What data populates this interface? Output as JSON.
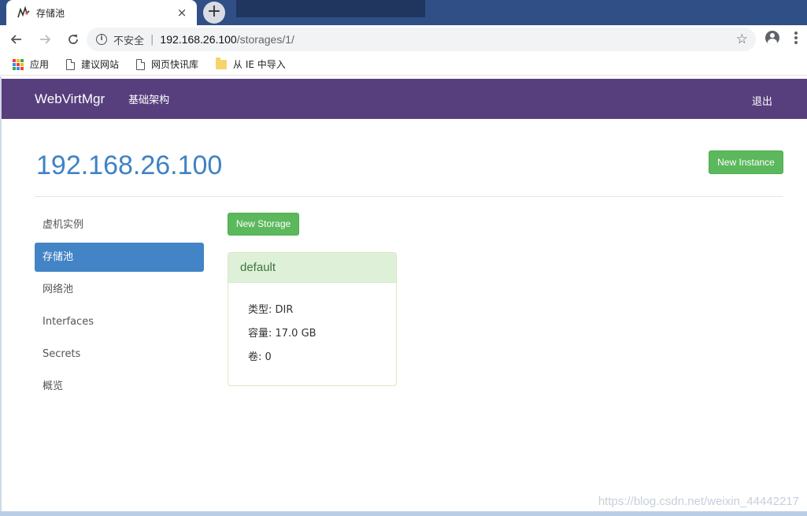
{
  "browser": {
    "tab_title": "存储池",
    "tab_close": "×",
    "new_tab": "+",
    "url_security": "不安全",
    "url_host": "192.168.26.100",
    "url_path": "/storages/1/",
    "bookmarks": [
      {
        "label": "应用",
        "icon": "apps-icon"
      },
      {
        "label": "建议网站",
        "icon": "page-icon"
      },
      {
        "label": "网页快讯库",
        "icon": "page-icon"
      },
      {
        "label": "从 IE 中导入",
        "icon": "folder-icon"
      }
    ]
  },
  "app": {
    "brand": "WebVirtMgr",
    "nav_infrastructure": "基础架构",
    "nav_logout": "退出",
    "host_title": "192.168.26.100",
    "new_instance_label": "New Instance",
    "sidebar": [
      {
        "label": "虚机实例",
        "active": false
      },
      {
        "label": "存储池",
        "active": true
      },
      {
        "label": "网络池",
        "active": false
      },
      {
        "label": "Interfaces",
        "active": false
      },
      {
        "label": "Secrets",
        "active": false
      },
      {
        "label": "概览",
        "active": false
      }
    ],
    "new_storage_label": "New Storage",
    "pool": {
      "name": "default",
      "type_line": "类型: DIR",
      "capacity_line": "容量: 17.0 GB",
      "volumes_line": "卷: 0"
    }
  },
  "watermark": "https://blog.csdn.net/weixin_44442217",
  "colors": {
    "navbar": "#573f7d",
    "primary": "#4284c6",
    "success": "#5cb85c",
    "panel_heading": "#dff0d8"
  }
}
